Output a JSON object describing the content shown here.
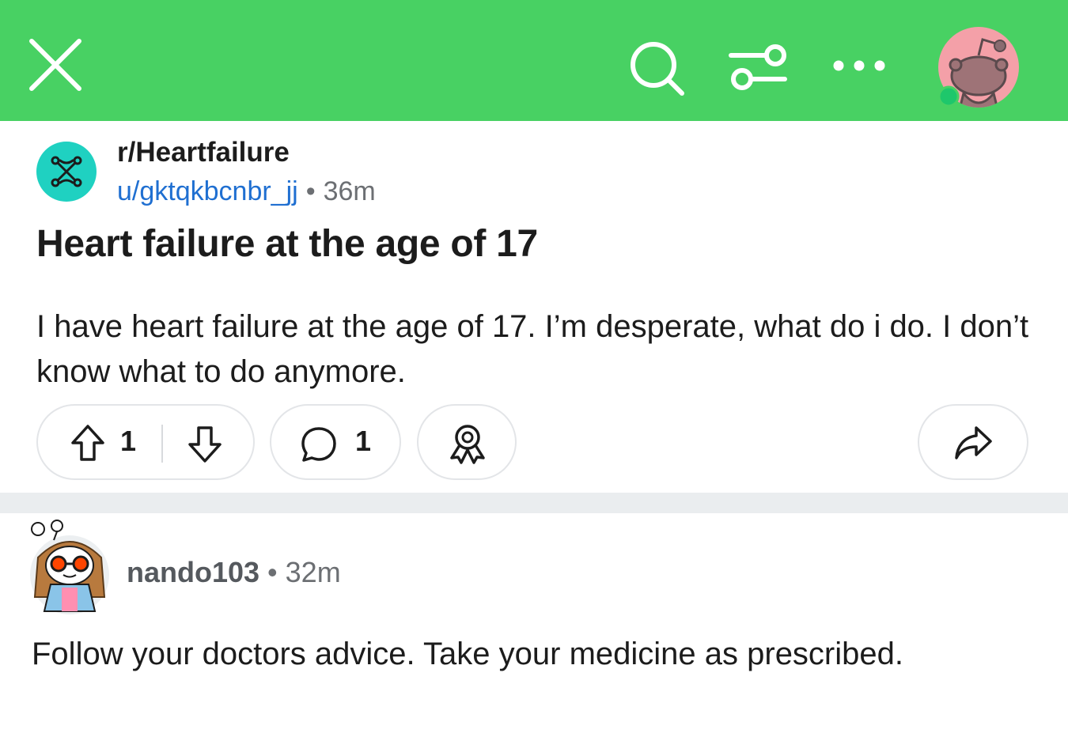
{
  "header": {
    "background_color": "#48d163",
    "icons": [
      "close-icon",
      "search-icon",
      "filter-icon",
      "more-icon",
      "user-avatar"
    ]
  },
  "post": {
    "subreddit": "r/Heartfailure",
    "author": "u/gktqkbcnbr_jj",
    "separator": "•",
    "time": "36m",
    "title": "Heart failure at the age of 17",
    "body": "I have heart failure at the age of 17. I’m desperate, what do i do. I don’t know what to do anymore.",
    "votes": "1",
    "comments": "1",
    "author_color": "#1f6fd1"
  },
  "comment": {
    "username": "nando103",
    "separator": "•",
    "time": "32m",
    "text": "Follow your doctors advice.  Take your medicine as prescribed."
  }
}
